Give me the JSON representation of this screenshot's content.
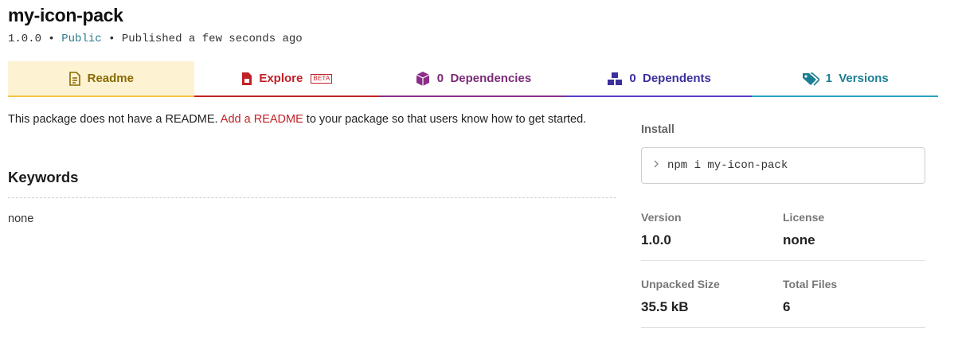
{
  "package": {
    "name": "my-icon-pack",
    "version": "1.0.0",
    "visibility": "Public",
    "published": "Published a few seconds ago",
    "separator": "•"
  },
  "tabs": {
    "readme": "Readme",
    "explore": "Explore",
    "explore_badge": "BETA",
    "dependencies": "0  Dependencies",
    "dependents": "0  Dependents",
    "versions": "1  Versions"
  },
  "readme": {
    "before": "This package does not have a README. ",
    "link": "Add a README",
    "after": " to your package so that users know how to get started."
  },
  "keywords": {
    "heading": "Keywords",
    "value": "none"
  },
  "sidebar": {
    "install_label": "Install",
    "install_command": "npm i my-icon-pack",
    "version_label": "Version",
    "version_value": "1.0.0",
    "license_label": "License",
    "license_value": "none",
    "size_label": "Unpacked Size",
    "size_value": "35.5 kB",
    "files_label": "Total Files",
    "files_value": "6"
  },
  "icons": {
    "readme": "document-icon",
    "explore": "file-code-icon",
    "dependencies": "box-icon",
    "dependents": "boxes-icon",
    "versions": "tags-icon",
    "prompt": "chevron-right-icon"
  },
  "colors": {
    "readme": "#f0c341",
    "explore": "#c12127",
    "dependencies": "#8b2c88",
    "dependents": "#5b3cc4",
    "versions": "#29a3bd",
    "public": "#2a7a8c"
  }
}
